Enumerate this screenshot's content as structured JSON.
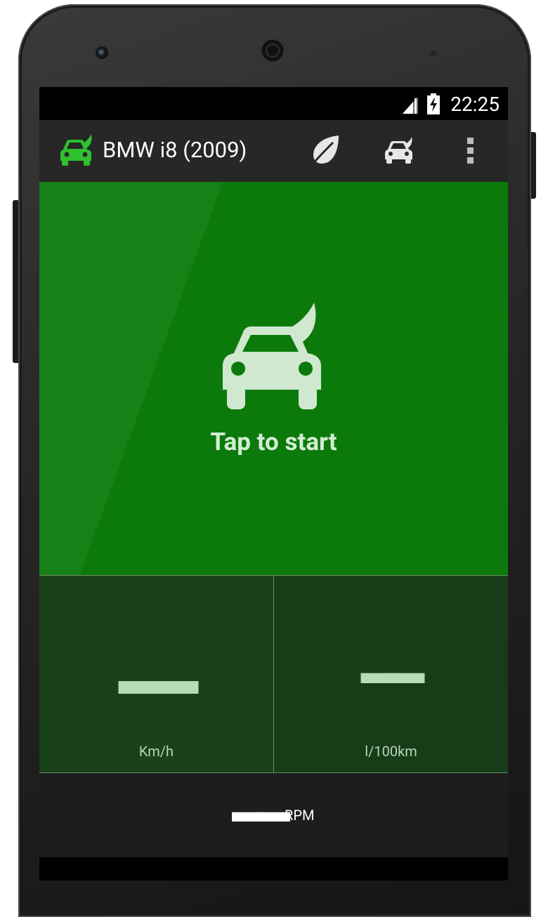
{
  "status_bar": {
    "time": "22:25"
  },
  "action_bar": {
    "title": "BMW i8 (2009)",
    "icons": [
      "app-car-leaf-icon",
      "leaf-icon",
      "car-icon",
      "overflow-menu-icon"
    ]
  },
  "main": {
    "start_label": "Tap to start",
    "icon": "car-leaf-icon"
  },
  "stats": {
    "speed": {
      "value": "▬▬",
      "unit": "Km/h"
    },
    "fuel": {
      "value": "▬▬",
      "unit": "l/100km"
    }
  },
  "rpm": {
    "value": "▬▬",
    "unit": "RPM"
  },
  "colors": {
    "main_panel": "#0b7a0b",
    "accent_green": "#2cb52c",
    "stats_bg": "#153b15",
    "action_bar": "#272727",
    "rpm_bar": "#1d1d1d"
  }
}
